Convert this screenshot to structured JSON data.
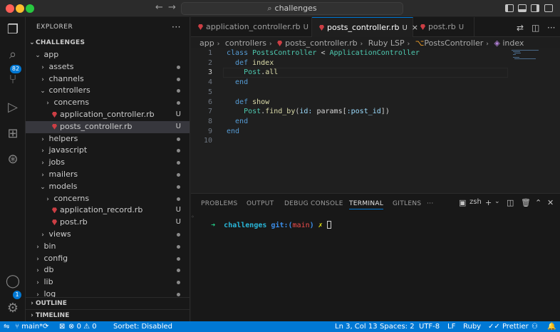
{
  "titlebar": {
    "search_text": "challenges"
  },
  "activity": {
    "scm_badge": "82",
    "accounts_badge": "1"
  },
  "sidebar": {
    "header": "EXPLORER",
    "more": "···",
    "section": "CHALLENGES",
    "tree": [
      {
        "label": "app",
        "indent": 0,
        "kind": "folder-open"
      },
      {
        "label": "assets",
        "indent": 1,
        "kind": "folder",
        "dot": true
      },
      {
        "label": "channels",
        "indent": 1,
        "kind": "folder",
        "dot": true
      },
      {
        "label": "controllers",
        "indent": 1,
        "kind": "folder-open",
        "dot": true
      },
      {
        "label": "concerns",
        "indent": 2,
        "kind": "folder",
        "dot": true
      },
      {
        "label": "application_controller.rb",
        "indent": 2,
        "kind": "ruby",
        "status": "U"
      },
      {
        "label": "posts_controller.rb",
        "indent": 2,
        "kind": "ruby",
        "status": "U",
        "selected": true
      },
      {
        "label": "helpers",
        "indent": 1,
        "kind": "folder",
        "dot": true
      },
      {
        "label": "javascript",
        "indent": 1,
        "kind": "folder",
        "dot": true
      },
      {
        "label": "jobs",
        "indent": 1,
        "kind": "folder",
        "dot": true
      },
      {
        "label": "mailers",
        "indent": 1,
        "kind": "folder",
        "dot": true
      },
      {
        "label": "models",
        "indent": 1,
        "kind": "folder-open",
        "dot": true
      },
      {
        "label": "concerns",
        "indent": 2,
        "kind": "folder",
        "dot": true
      },
      {
        "label": "application_record.rb",
        "indent": 2,
        "kind": "ruby",
        "status": "U"
      },
      {
        "label": "post.rb",
        "indent": 2,
        "kind": "ruby",
        "status": "U"
      },
      {
        "label": "views",
        "indent": 1,
        "kind": "folder",
        "dot": true
      },
      {
        "label": "bin",
        "indent": 0,
        "kind": "folder",
        "dot": true
      },
      {
        "label": "config",
        "indent": 0,
        "kind": "folder",
        "dot": true
      },
      {
        "label": "db",
        "indent": 0,
        "kind": "folder",
        "dot": true
      },
      {
        "label": "lib",
        "indent": 0,
        "kind": "folder",
        "dot": true
      },
      {
        "label": "log",
        "indent": 0,
        "kind": "folder",
        "dot": true
      }
    ],
    "outline": "OUTLINE",
    "timeline": "TIMELINE"
  },
  "tabs": [
    {
      "label": "application_controller.rb",
      "status": "U",
      "active": false
    },
    {
      "label": "posts_controller.rb",
      "status": "U",
      "active": true,
      "close": "×"
    },
    {
      "label": "post.rb",
      "status": "U",
      "active": false
    }
  ],
  "breadcrumb": [
    "app",
    "controllers",
    "posts_controller.rb",
    "Ruby LSP",
    "PostsController",
    "index"
  ],
  "editor": {
    "current_line": 3,
    "lines": [
      [
        {
          "t": "class ",
          "c": "kw"
        },
        {
          "t": "PostsController",
          "c": "cls"
        },
        {
          "t": " < ",
          "c": "txt"
        },
        {
          "t": "ApplicationController",
          "c": "cls"
        }
      ],
      [
        {
          "t": "  def ",
          "c": "kw"
        },
        {
          "t": "index",
          "c": "fn"
        }
      ],
      [
        {
          "t": "    Post",
          "c": "cls"
        },
        {
          "t": ".",
          "c": "txt"
        },
        {
          "t": "all",
          "c": "fn"
        }
      ],
      [
        {
          "t": "  end",
          "c": "kw"
        }
      ],
      [],
      [
        {
          "t": "  def ",
          "c": "kw"
        },
        {
          "t": "show",
          "c": "fn"
        }
      ],
      [
        {
          "t": "    Post",
          "c": "cls"
        },
        {
          "t": ".",
          "c": "txt"
        },
        {
          "t": "find_by",
          "c": "fn"
        },
        {
          "t": "(",
          "c": "txt"
        },
        {
          "t": "id:",
          "c": "sym"
        },
        {
          "t": " params[",
          "c": "txt"
        },
        {
          "t": ":post_id",
          "c": "sym"
        },
        {
          "t": "])",
          "c": "txt"
        }
      ],
      [
        {
          "t": "  end",
          "c": "kw"
        }
      ],
      [
        {
          "t": "end",
          "c": "kw"
        }
      ],
      []
    ]
  },
  "panel": {
    "tabs": [
      "PROBLEMS",
      "OUTPUT",
      "DEBUG CONSOLE",
      "TERMINAL",
      "GITLENS",
      "···"
    ],
    "active_tab": "TERMINAL",
    "shell": "zsh",
    "prompt": {
      "arrow": "➜",
      "dir": "challenges",
      "git": "git:(",
      "branch": "main",
      "git_close": ")",
      "x": "✗"
    }
  },
  "statusbar": {
    "branch": "main*",
    "errors": "0",
    "warnings": "0",
    "sorbet": "Sorbet: Disabled",
    "position": "Ln 3, Col 13",
    "spaces": "Spaces: 2",
    "encoding": "UTF-8",
    "eol": "LF",
    "language": "Ruby",
    "prettier": "Prettier"
  },
  "colors": {
    "accent": "#0078d4",
    "ruby": "#cc3e44"
  }
}
